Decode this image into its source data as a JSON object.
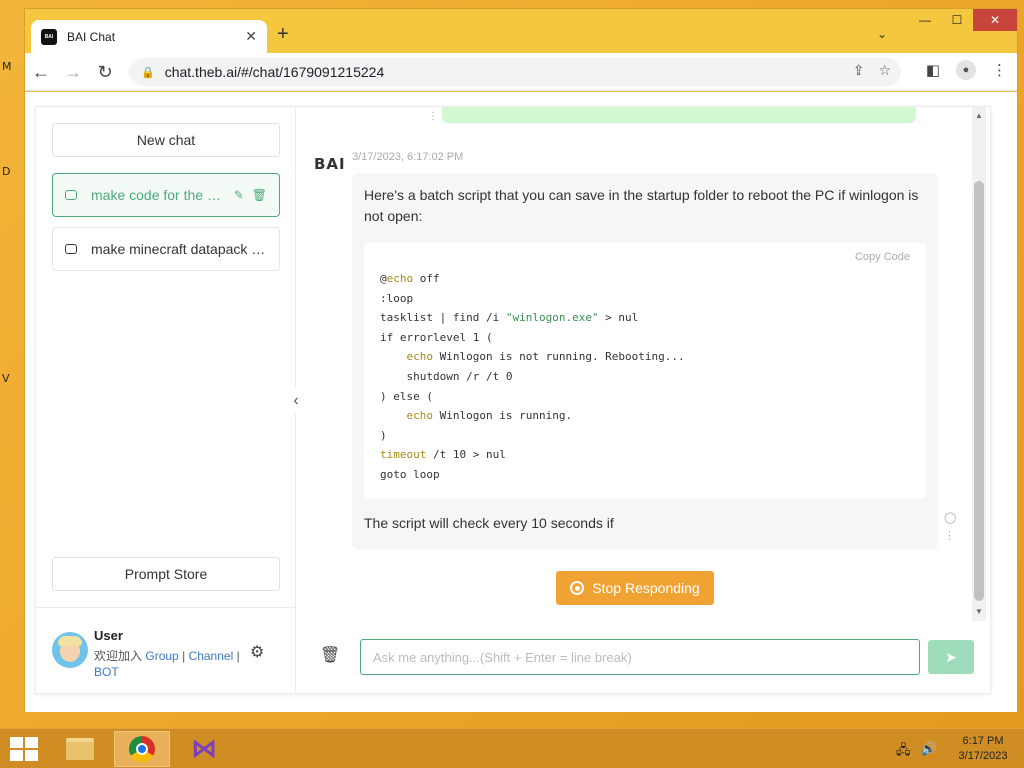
{
  "desktop": {
    "side_letters": [
      "M",
      "D",
      "V"
    ]
  },
  "browser": {
    "tab": {
      "title": "BAI Chat",
      "favicon_text": "BAI"
    },
    "url": "chat.theb.ai/#/chat/1679091215224",
    "window_controls": {
      "minimize": "—",
      "maximize": "☐",
      "close": "✕"
    }
  },
  "sidebar": {
    "new_chat_label": "New chat",
    "history": [
      {
        "label": "make code for the winlogon restart",
        "active": true
      },
      {
        "label": "make minecraft datapack code",
        "active": false
      }
    ],
    "prompt_store_label": "Prompt Store",
    "user": {
      "name": "User",
      "welcome_text": "欢迎加入",
      "links": [
        "Group",
        "Channel",
        "BOT"
      ],
      "separator": "|"
    }
  },
  "chat": {
    "bot_logo": "BAI",
    "timestamp": "3/17/2023, 6:17:02 PM",
    "reply_intro": "Here's a batch script that you can save in the startup folder to reboot the PC if winlogon is not open:",
    "copy_code_label": "Copy  Code",
    "code_lines": [
      "@echo off",
      ":loop",
      "tasklist | find /i \"winlogon.exe\" > nul",
      "if errorlevel 1 (",
      "    echo Winlogon is not running. Rebooting...",
      "    shutdown /r /t 0",
      ") else (",
      "    echo Winlogon is running.",
      ")",
      "timeout /t 10 > nul",
      "goto loop"
    ],
    "reply_tail": "The script will check every 10 seconds if",
    "stop_label": "Stop Responding",
    "input_placeholder": "Ask me anything...(Shift + Enter = line break)"
  },
  "taskbar": {
    "time": "6:17 PM",
    "date": "3/17/2023"
  },
  "colors": {
    "accent": "#4eaa7a",
    "stop_button": "#f0a232",
    "desktop": "#e8a42a"
  }
}
